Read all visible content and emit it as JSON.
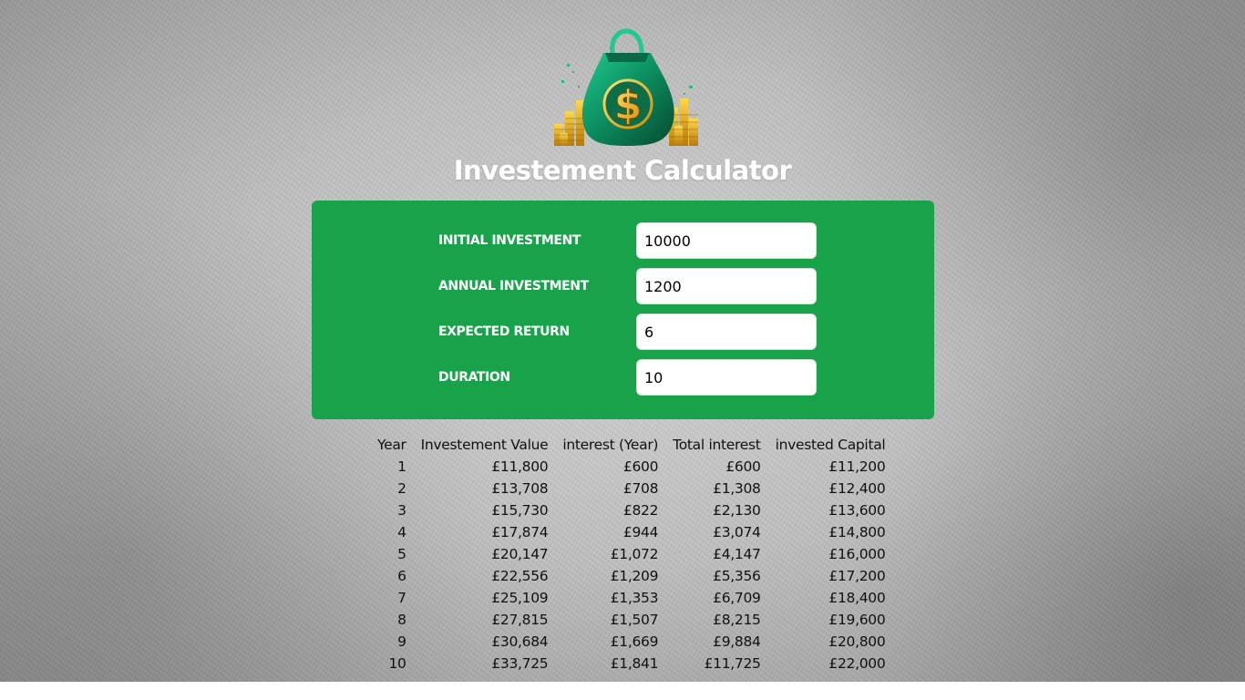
{
  "app": {
    "title": "Investement Calculator",
    "logo_icon": "money-bag-dollar-icon",
    "accent_color": "#18a34a"
  },
  "inputs": [
    {
      "label": "INITIAL INVESTMENT",
      "value": "10000"
    },
    {
      "label": "ANNUAL INVESTMENT",
      "value": "1200"
    },
    {
      "label": "EXPECTED RETURN",
      "value": "6"
    },
    {
      "label": "DURATION",
      "value": "10"
    }
  ],
  "results": {
    "headers": [
      "Year",
      "Investement Value",
      "interest (Year)",
      "Total interest",
      "invested Capital"
    ],
    "rows": [
      [
        "1",
        "£11,800",
        "£600",
        "£600",
        "£11,200"
      ],
      [
        "2",
        "£13,708",
        "£708",
        "£1,308",
        "£12,400"
      ],
      [
        "3",
        "£15,730",
        "£822",
        "£2,130",
        "£13,600"
      ],
      [
        "4",
        "£17,874",
        "£944",
        "£3,074",
        "£14,800"
      ],
      [
        "5",
        "£20,147",
        "£1,072",
        "£4,147",
        "£16,000"
      ],
      [
        "6",
        "£22,556",
        "£1,209",
        "£5,356",
        "£17,200"
      ],
      [
        "7",
        "£25,109",
        "£1,353",
        "£6,709",
        "£18,400"
      ],
      [
        "8",
        "£27,815",
        "£1,507",
        "£8,215",
        "£19,600"
      ],
      [
        "9",
        "£30,684",
        "£1,669",
        "£9,884",
        "£20,800"
      ],
      [
        "10",
        "£33,725",
        "£1,841",
        "£11,725",
        "£22,000"
      ]
    ]
  }
}
